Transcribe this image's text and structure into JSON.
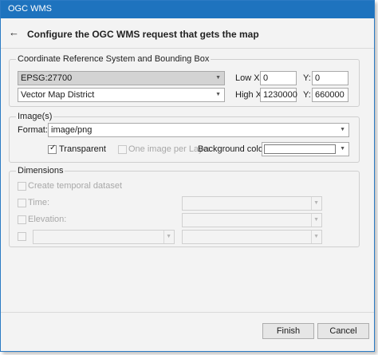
{
  "window": {
    "title": "OGC WMS"
  },
  "header": {
    "heading": "Configure the OGC WMS request that gets the map"
  },
  "crs_group": {
    "label": "Coordinate Reference System and Bounding Box",
    "crs_value": "EPSG:27700",
    "layer_value": "Vector Map District",
    "low_x_label": "Low X:",
    "low_x_value": "0",
    "low_y_label": "Y:",
    "low_y_value": "0",
    "high_x_label": "High X:",
    "high_x_value": "1230000",
    "high_y_label": "Y:",
    "high_y_value": "660000"
  },
  "images_group": {
    "label": "Image(s)",
    "format_label": "Format:",
    "format_value": "image/png",
    "transparent_label": "Transparent",
    "transparent_checked": true,
    "one_image_label": "One image per Layer",
    "bg_colour_label": "Background colour:",
    "bg_colour_value": ""
  },
  "dimensions_group": {
    "label": "Dimensions",
    "create_temporal_label": "Create temporal dataset",
    "time_label": "Time:",
    "elevation_label": "Elevation:"
  },
  "buttons": {
    "finish": "Finish",
    "cancel": "Cancel"
  },
  "colors": {
    "titlebar": "#1e73be",
    "window_bg": "#f3f3f3"
  },
  "icons": {
    "back": "←",
    "dropdown": "▼",
    "check": "✓"
  }
}
